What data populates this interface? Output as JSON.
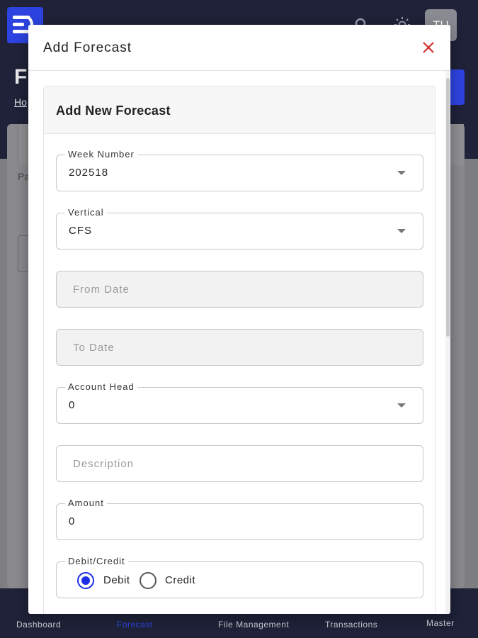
{
  "app": {
    "logo_icon": "menu-logo-icon",
    "search_icon": "search-icon",
    "theme_icon": "sun-icon",
    "avatar_initials": "TU",
    "page_title": "F",
    "breadcrumb": "Ho",
    "background_label": "Pa"
  },
  "bottom_nav": {
    "items": [
      {
        "label": "Dashboard"
      },
      {
        "label": "Forecast"
      },
      {
        "label": "File Management"
      },
      {
        "label": "Transactions"
      },
      {
        "label": "Master"
      }
    ],
    "active": "Forecast"
  },
  "modal": {
    "title": "Add Forecast",
    "close_icon": "close-icon",
    "form_title": "Add New Forecast",
    "fields": {
      "week_number": {
        "label": "Week Number",
        "value": "202518"
      },
      "vertical": {
        "label": "Vertical",
        "value": "CFS"
      },
      "from_date": {
        "placeholder": "From Date"
      },
      "to_date": {
        "placeholder": "To Date"
      },
      "account_head": {
        "label": "Account Head",
        "value": "0"
      },
      "description": {
        "placeholder": "Description"
      },
      "amount": {
        "label": "Amount",
        "value": "0"
      },
      "debit_credit": {
        "label": "Debit/Credit",
        "options": [
          "Debit",
          "Credit"
        ],
        "selected": "Debit"
      }
    }
  },
  "colors": {
    "primary": "#2d43e0",
    "radio_selected": "#1d2ee6",
    "close": "#d32f2f",
    "header_bg": "#1f2238"
  }
}
